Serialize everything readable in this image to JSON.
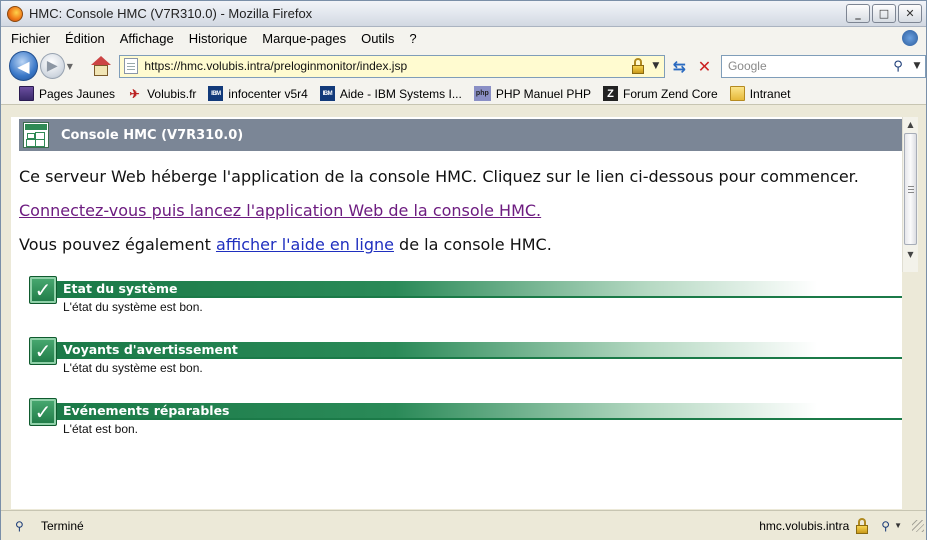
{
  "window": {
    "title": "HMC: Console HMC (V7R310.0) - Mozilla Firefox"
  },
  "menubar": {
    "items": [
      "Fichier",
      "Édition",
      "Affichage",
      "Historique",
      "Marque-pages",
      "Outils",
      "?"
    ]
  },
  "navbar": {
    "url": "https://hmc.volubis.intra/preloginmonitor/index.jsp",
    "search_placeholder": "Google"
  },
  "bookmarks": [
    {
      "label": "Pages Jaunes",
      "icon": "book-icon"
    },
    {
      "label": "Volubis.fr",
      "icon": "volubis-icon"
    },
    {
      "label": "infocenter v5r4",
      "icon": "ibm-icon"
    },
    {
      "label": "Aide - IBM Systems I...",
      "icon": "ibm-icon"
    },
    {
      "label": "PHP Manuel PHP",
      "icon": "php-icon"
    },
    {
      "label": "Forum Zend Core",
      "icon": "zend-icon"
    },
    {
      "label": "Intranet",
      "icon": "folder-icon"
    }
  ],
  "page": {
    "banner_title": "Console HMC (V7R310.0)",
    "intro": "Ce serveur Web héberge l'application de la console HMC.  Cliquez sur le lien ci-dessous pour commencer.",
    "launch_link": "Connectez-vous puis lancez l'application Web de la console HMC.",
    "help_prefix": "Vous pouvez également ",
    "help_link": "afficher l'aide en ligne",
    "help_suffix": " de la console HMC.",
    "statuses": [
      {
        "title": "Etat du système",
        "message": "L'état du système est bon."
      },
      {
        "title": "Voyants d'avertissement",
        "message": "L'état du système est bon."
      },
      {
        "title": "Evénements réparables",
        "message": "L'état est bon."
      }
    ]
  },
  "statusbar": {
    "text": "Terminé",
    "host": "hmc.volubis.intra"
  },
  "colors": {
    "banner": "#7b8696",
    "status_green": "#1b7a48",
    "visited_link": "#6d1c80",
    "link": "#1f2fbf"
  }
}
